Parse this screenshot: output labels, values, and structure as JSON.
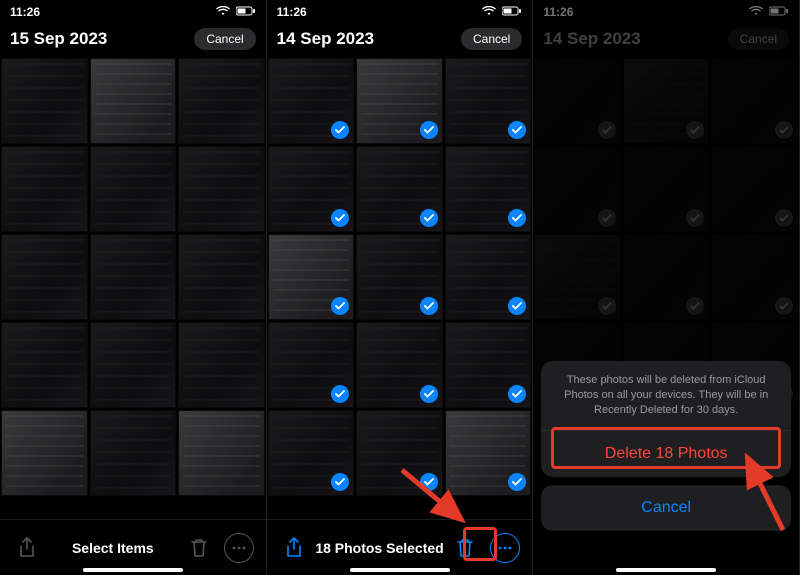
{
  "panel1": {
    "time": "11:26",
    "date": "15 Sep 2023",
    "cancel": "Cancel",
    "toolbar_center": "Select Items"
  },
  "panel2": {
    "time": "11:26",
    "date": "14 Sep 2023",
    "cancel": "Cancel",
    "toolbar_center": "18 Photos Selected"
  },
  "panel3": {
    "time": "11:26",
    "date": "14 Sep 2023",
    "cancel": "Cancel",
    "sheet_msg": "These photos will be deleted from iCloud Photos on all your devices. They will be in Recently Deleted for 30 days.",
    "sheet_action": "Delete 18 Photos",
    "sheet_cancel": "Cancel"
  },
  "icons": {
    "share": "share-icon",
    "trash": "trash-icon",
    "more": "more-icon",
    "wifi": "wifi-icon",
    "battery": "battery-icon"
  }
}
